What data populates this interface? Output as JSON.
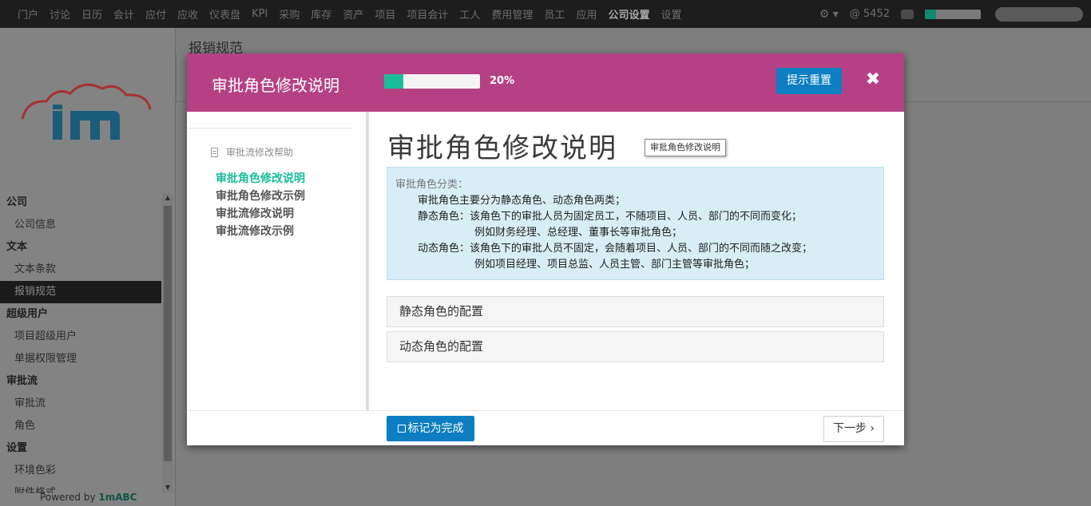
{
  "topnav": {
    "items": [
      "门户",
      "讨论",
      "日历",
      "会计",
      "应付",
      "应收",
      "仪表盘",
      "KPI",
      "采购",
      "库存",
      "资产",
      "项目",
      "项目会计",
      "工人",
      "费用管理",
      "员工",
      "应用",
      "公司设置",
      "设置"
    ],
    "active_item": "公司设置",
    "gear_icon": "gear-icon",
    "at_count": "@ 5452",
    "chat_icon": "chat-icon"
  },
  "sidebar": {
    "logo": "1m-cloud-logo",
    "sections": [
      {
        "title": "公司",
        "items": [
          "公司信息"
        ]
      },
      {
        "title": "文本",
        "items": [
          "文本条款",
          "报销规范"
        ]
      },
      {
        "title": "超级用户",
        "items": [
          "项目超级用户",
          "单据权限管理"
        ]
      },
      {
        "title": "审批流",
        "items": [
          "审批流",
          "角色"
        ]
      },
      {
        "title": "设置",
        "items": [
          "环境色彩",
          "附件格式"
        ]
      }
    ],
    "active_item": "报销规范",
    "powered_prefix": "Powered by ",
    "powered_brand": "1mABC"
  },
  "page": {
    "title": "报销规范"
  },
  "modal": {
    "title": "审批角色修改说明",
    "progress_percent": 20,
    "progress_label": "20%",
    "reset_label": "提示重置",
    "close_icon": "close-icon",
    "nav_help": "审批流修改帮助",
    "nav_links": [
      "审批角色修改说明",
      "审批角色修改示例",
      "审批流修改说明",
      "审批流修改示例"
    ],
    "active_link": "审批角色修改说明",
    "content_title": "审批角色修改说明",
    "tooltip": "审批角色修改说明",
    "info": {
      "title": "审批角色分类：",
      "lines": [
        {
          "level": 1,
          "text": "审批角色主要分为静态角色、动态角色两类；"
        },
        {
          "level": 1,
          "text": "静态角色：该角色下的审批人员为固定员工，不随项目、人员、部门的不同而变化；"
        },
        {
          "level": 2,
          "text": "例如财务经理、总经理、董事长等审批角色；"
        },
        {
          "level": 1,
          "text": "动态角色：该角色下的审批人员不固定，会随着项目、人员、部门的不同而随之改变；"
        },
        {
          "level": 2,
          "text": "例如项目经理、项目总监、人员主管、部门主管等审批角色；"
        }
      ]
    },
    "accordion": [
      "静态角色的配置",
      "动态角色的配置"
    ],
    "done_label": "标记为完成",
    "next_label": "下一步 ›"
  },
  "colors": {
    "modal_header": "#b54184",
    "accent_teal": "#1abc9c",
    "button_blue": "#0d7ec2",
    "info_bg": "#d9edf7"
  }
}
